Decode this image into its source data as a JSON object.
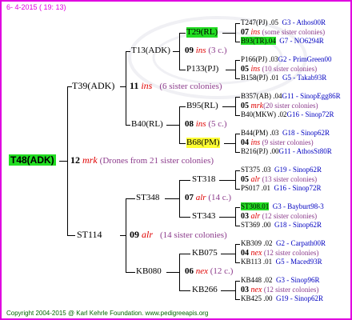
{
  "stamp": "6- 4-2015 ( 19: 13)",
  "copyright": "Copyright 2004-2015 @ Karl Kehrle Foundation.   www.pedigreeapis.org",
  "root": {
    "id": "T48(ADK)",
    "num": "12",
    "tag": "mrk",
    "note": "(Drones from 21 sister colonies)"
  },
  "gen1": [
    {
      "id": "T39(ADK)",
      "num": "11",
      "tag": "ins",
      "note": "(6 sister colonies)"
    },
    {
      "id": "ST114",
      "num": "09",
      "tag": "alr",
      "note": "(14 sister colonies)"
    }
  ],
  "gen2": [
    {
      "id": "T13(ADK)",
      "num": "09",
      "tag": "ins",
      "note": "(3 c.)"
    },
    {
      "id": "B40(RL)",
      "num": "08",
      "tag": "ins",
      "note": "(5 c.)"
    },
    {
      "id": "ST348",
      "num": "07",
      "tag": "alr",
      "note": "(14 c.)"
    },
    {
      "id": "KB080",
      "num": "06",
      "tag": "nex",
      "note": "(12 c.)"
    }
  ],
  "gen3": [
    {
      "id": "T29(RL)",
      "num": "07",
      "tag": "ins",
      "note": "(some sister colonies)"
    },
    {
      "id": "P133(PJ)",
      "num": "05",
      "tag": "ins",
      "note": "(10 sister colonies)"
    },
    {
      "id": "B95(RL)",
      "num": "05",
      "tag": "mrk",
      "note": "(20 sister colonies)"
    },
    {
      "id": "B68(PM)",
      "num": "04",
      "tag": "ins",
      "note": "(9 sister colonies)"
    },
    {
      "id": "ST318",
      "num": "05",
      "tag": "alr",
      "note": "(13 sister colonies)"
    },
    {
      "id": "ST343",
      "num": "03",
      "tag": "alr",
      "note": "(12 sister colonies)"
    },
    {
      "id": "KB075",
      "num": "04",
      "tag": "nex",
      "note": "(12 sister colonies)"
    },
    {
      "id": "KB266",
      "num": "03",
      "tag": "nex",
      "note": "(12 sister colonies)"
    }
  ],
  "gen4": [
    {
      "id": "T247(PJ)",
      "num": ".05",
      "loc": "G3 - Athos00R"
    },
    {
      "id": "B93(TR)",
      "num": ".04",
      "loc": "G7 - NO6294R"
    },
    {
      "id": "P166(PJ)",
      "num": ".03",
      "loc": "G2 - PrimGreen00"
    },
    {
      "id": "B158(PJ)",
      "num": ".01",
      "loc": "G5 - Takab93R"
    },
    {
      "id": "B357(AB)",
      "num": ".04",
      "loc": "G11 - SinopEgg86R"
    },
    {
      "id": "B40(MKW)",
      "num": ".02",
      "loc": "G16 - Sinop72R"
    },
    {
      "id": "B44(PM)",
      "num": ".03",
      "loc": "G18 - Sinop62R"
    },
    {
      "id": "B216(PJ)",
      "num": ".00",
      "loc": "G11 - AthosSt80R"
    },
    {
      "id": "ST375",
      "num": ".03",
      "loc": "G19 - Sinop62R"
    },
    {
      "id": "PS017",
      "num": ".01",
      "loc": "G16 - Sinop72R"
    },
    {
      "id": "ST308",
      "num": ".01",
      "loc": "G3 - Bayburt98-3"
    },
    {
      "id": "ST369",
      "num": ".00",
      "loc": "G18 - Sinop62R"
    },
    {
      "id": "KB309",
      "num": ".02",
      "loc": "G2 - Carpath00R"
    },
    {
      "id": "KB113",
      "num": ".01",
      "loc": "G5 - Maced93R"
    },
    {
      "id": "KB448",
      "num": ".02",
      "loc": "G3 - Sinop96R"
    },
    {
      "id": "KB425",
      "num": ".00",
      "loc": "G19 - Sinop62R"
    }
  ],
  "colors": {
    "frame": "#e000e0",
    "highlight_green": "#22dd22",
    "highlight_yellow": "#ffff33",
    "tag_red": "#e00000",
    "note_purple": "#8b3a8b",
    "loc_blue": "#0000c0"
  }
}
